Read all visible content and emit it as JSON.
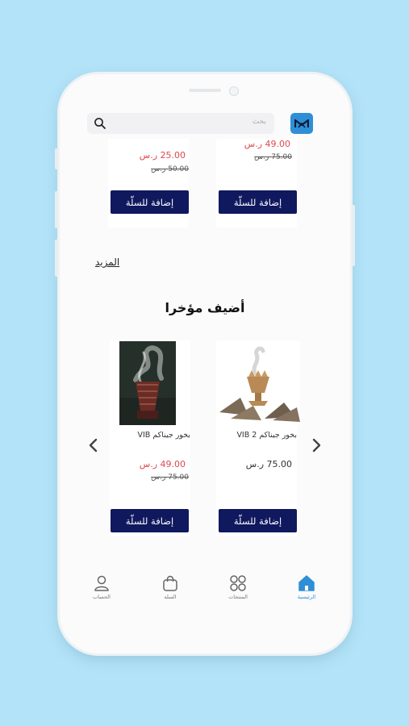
{
  "header": {
    "search_placeholder": "بحث"
  },
  "top_products": [
    {
      "price_new": "25.00 ر.س",
      "price_old": "50.00 ر.س",
      "add_label": "إضافة للسلّة"
    },
    {
      "price_new": "49.00 ر.س",
      "price_old": "75.00 ر.س",
      "add_label": "إضافة للسلّة"
    }
  ],
  "more_label": "المزيد",
  "recent_section": {
    "title": "أضيف مؤخرا",
    "products": [
      {
        "name": "بخور جيناكم VIB",
        "price_new": "49.00 ر.س",
        "price_old": "75.00 ر.س",
        "add_label": "إضافة للسلّة"
      },
      {
        "name": "بخور جيناكم VIB 2",
        "price": "75.00 ر.س",
        "add_label": "إضافة للسلّة"
      }
    ]
  },
  "bottom_nav": [
    {
      "label": "الحساب",
      "icon": "user-icon"
    },
    {
      "label": "السله",
      "icon": "bag-icon"
    },
    {
      "label": "المنتجات",
      "icon": "grid-icon"
    },
    {
      "label": "الرئيسية",
      "icon": "home-icon",
      "active": true
    }
  ],
  "colors": {
    "background": "#b3e3f8",
    "button": "#10185e",
    "sale_price": "#e0484f",
    "accent": "#2f8fd6"
  }
}
